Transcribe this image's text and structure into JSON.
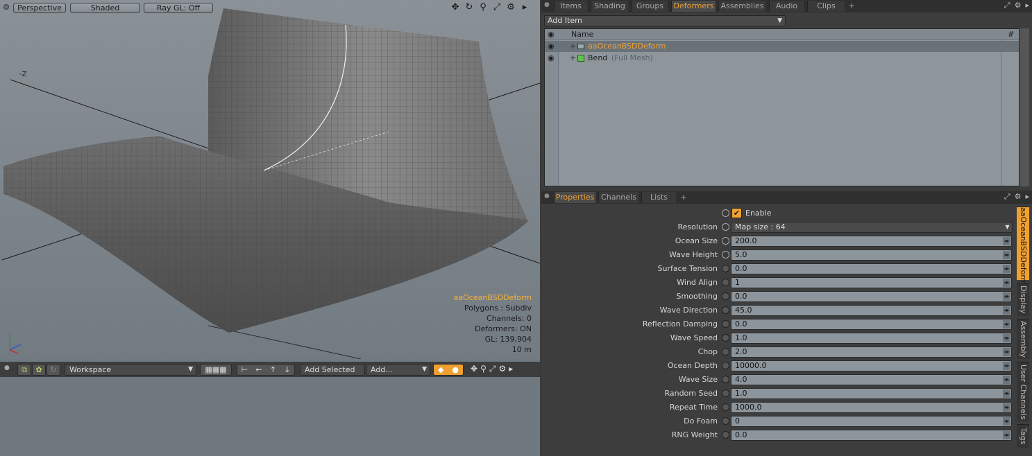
{
  "viewport": {
    "toolbar": {
      "view_mode": "Perspective",
      "shading": "Shaded",
      "raygl": "Ray GL: Off"
    },
    "axis_label": "-Z",
    "info": {
      "item_name": "aaOceanBSDDeform",
      "polygons": "Polygons : Subdiv",
      "channels": "Channels: 0",
      "deformers": "Deformers: ON",
      "gl": "GL: 139,904",
      "scale": "10 m"
    },
    "nav_icons": [
      "move-icon",
      "rotate-icon",
      "zoom-icon",
      "fit-icon",
      "gear-icon",
      "arrow-right-icon"
    ]
  },
  "lower_left": {
    "workspace_label": "Workspace",
    "add_selected_label": "Add Selected",
    "add_label": "Add..."
  },
  "items_panel": {
    "tabs": [
      "Items",
      "Shading",
      "Groups",
      "Deformers",
      "Assemblies",
      "Audio",
      "Clips",
      "+"
    ],
    "active_tab": "Deformers",
    "add_item_label": "Add Item",
    "column_name": "Name",
    "column_hash": "#",
    "rows": [
      {
        "name": "aaOceanBSDDeform",
        "suffix": "",
        "selected": true
      },
      {
        "name": "Bend",
        "suffix": "(Full Mesh)",
        "selected": false
      }
    ]
  },
  "properties_panel": {
    "tabs": [
      "Properties",
      "Channels",
      "Lists",
      "+"
    ],
    "active_tab": "Properties",
    "enable_label": "Enable",
    "fields": [
      {
        "label": "Resolution",
        "value": "Map size : 64",
        "type": "dropdown"
      },
      {
        "label": "Ocean Size",
        "value": "200.0"
      },
      {
        "label": "Wave Height",
        "value": "5.0"
      },
      {
        "label": "Surface Tension",
        "value": "0.0"
      },
      {
        "label": "Wind Align",
        "value": "1"
      },
      {
        "label": "Smoothing",
        "value": "0.0"
      },
      {
        "label": "Wave Direction",
        "value": "45.0"
      },
      {
        "label": "Reflection Damping",
        "value": "0.0"
      },
      {
        "label": "Wave Speed",
        "value": "1.0"
      },
      {
        "label": "Chop",
        "value": "2.0"
      },
      {
        "label": "Ocean Depth",
        "value": "10000.0"
      },
      {
        "label": "Wave Size",
        "value": "4.0"
      },
      {
        "label": "Random Seed",
        "value": "1.0"
      },
      {
        "label": "Repeat Time",
        "value": "1000.0"
      },
      {
        "label": "Do Foam",
        "value": "0"
      },
      {
        "label": "RNG Weight",
        "value": "0.0"
      }
    ],
    "side_tabs": [
      "aaOceanBSDDeform",
      "Display",
      "Assembly",
      "User Channels",
      "Tags"
    ]
  },
  "colors": {
    "accent": "#f0a030",
    "panel": "#3d3d3d",
    "viewport_bg": "#80888f"
  }
}
